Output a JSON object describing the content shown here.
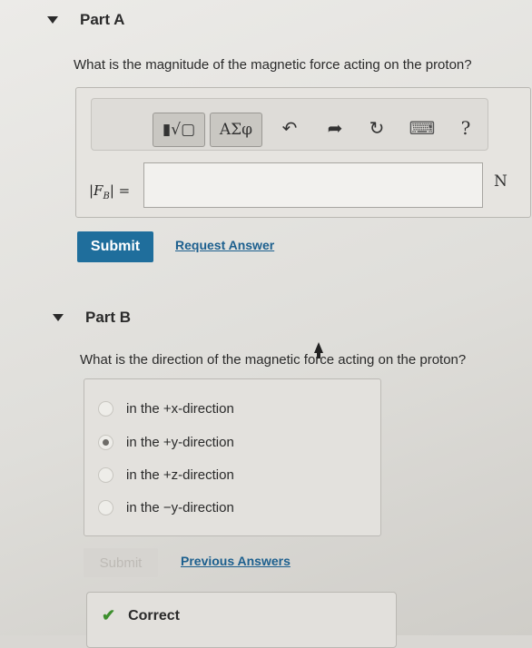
{
  "partA": {
    "title": "Part A",
    "question": "What is the magnitude of the magnetic force acting on the proton?",
    "toolbar": {
      "templates_icon": "▮√▢",
      "greek_label": "ΑΣφ",
      "undo_icon": "↶",
      "redo_icon": "➦",
      "reset_icon": "↻",
      "keyboard_icon": "⌨",
      "help_label": "?"
    },
    "input_label": "|F",
    "input_sub": "B",
    "input_label_end": "| =",
    "input_value": "",
    "unit": "N",
    "submit": "Submit",
    "request": "Request Answer"
  },
  "partB": {
    "title": "Part B",
    "question": "What is the direction of the magnetic force acting on the proton?",
    "options": [
      "in the +x-direction",
      "in the +y-direction",
      "in the +z-direction",
      "in the −y-direction"
    ],
    "selected_index": 1,
    "submit": "Submit",
    "previous": "Previous Answers",
    "result": "Correct"
  },
  "colors": {
    "submit": "#1f6e9c",
    "link": "#1c5f8e",
    "check": "#3d8f2d"
  }
}
